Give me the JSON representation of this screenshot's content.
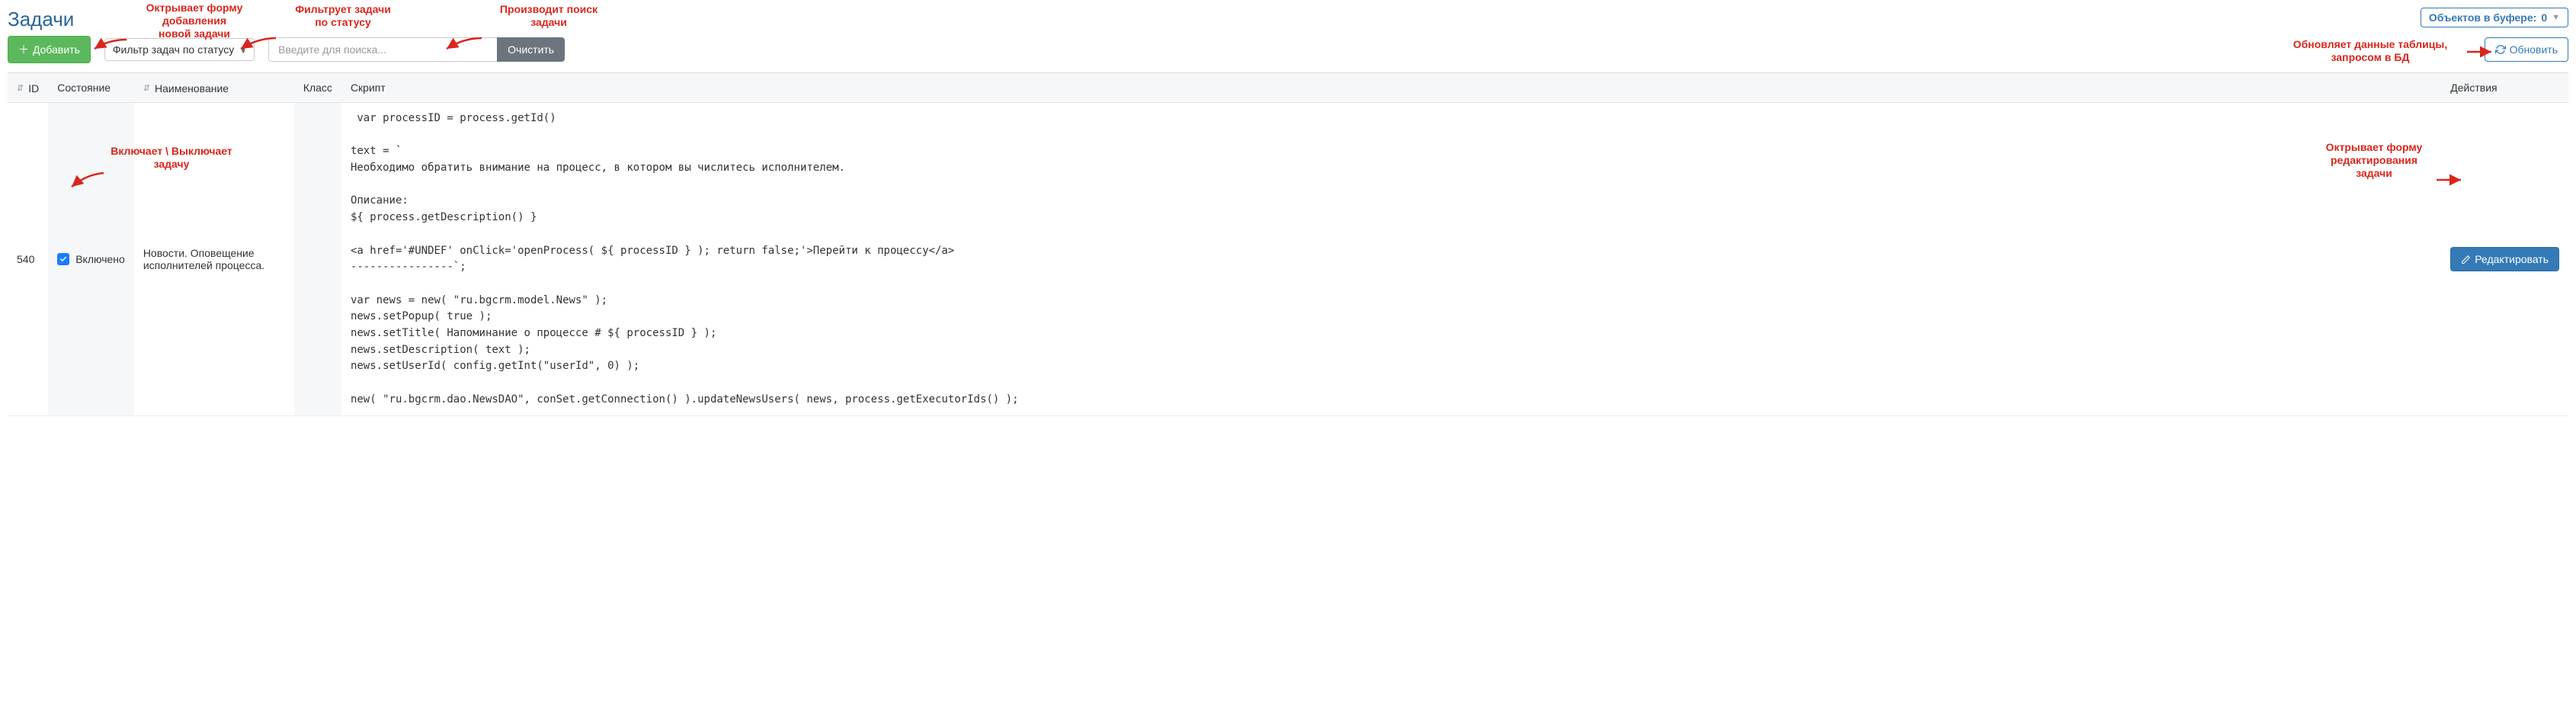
{
  "page": {
    "title": "Задачи",
    "buffer_label": "Объектов в буфере:",
    "buffer_count": "0"
  },
  "toolbar": {
    "add_label": "Добавить",
    "filter_label": "Фильтр задач по статусу",
    "search_placeholder": "Введите для поиска...",
    "clear_label": "Очистить",
    "refresh_label": "Обновить"
  },
  "annotations": {
    "add": "Октрывает форму\nдобавления\nновой задачи",
    "filter": "Фильтрует задачи\nпо статусу",
    "search": "Производит поиск\nзадачи",
    "refresh": "Обновляет данные таблицы,\nзапросом в БД",
    "toggle": "Включает \\ Выключает\nзадачу",
    "edit": "Октрывает форму\nредактирования\nзадачи"
  },
  "columns": {
    "id": "ID",
    "state": "Состояние",
    "name": "Наименование",
    "class": "Класс",
    "script": "Скрипт",
    "actions": "Действия"
  },
  "row": {
    "id": "540",
    "state": "Включено",
    "name": "Новости. Оповещение исполнителей процесса.",
    "class": "",
    "script": " var processID = process.getId()\n\ntext = `\nНеобходимо обратить внимание на процесс, в котором вы числитесь исполнителем.\n\nОписание:\n${ process.getDescription() }\n\n<a href='#UNDEF' onClick='openProcess( ${ processID } ); return false;'>Перейти к процессу</a>\n----------------`;\n\nvar news = new( \"ru.bgcrm.model.News\" );\nnews.setPopup( true );\nnews.setTitle( Напоминание о процессе # ${ processID } );\nnews.setDescription( text );\nnews.setUserId( config.getInt(\"userId\", 0) );\n\nnew( \"ru.bgcrm.dao.NewsDAO\", conSet.getConnection() ).updateNewsUsers( news, process.getExecutorIds() );",
    "edit_label": "Редактировать"
  }
}
